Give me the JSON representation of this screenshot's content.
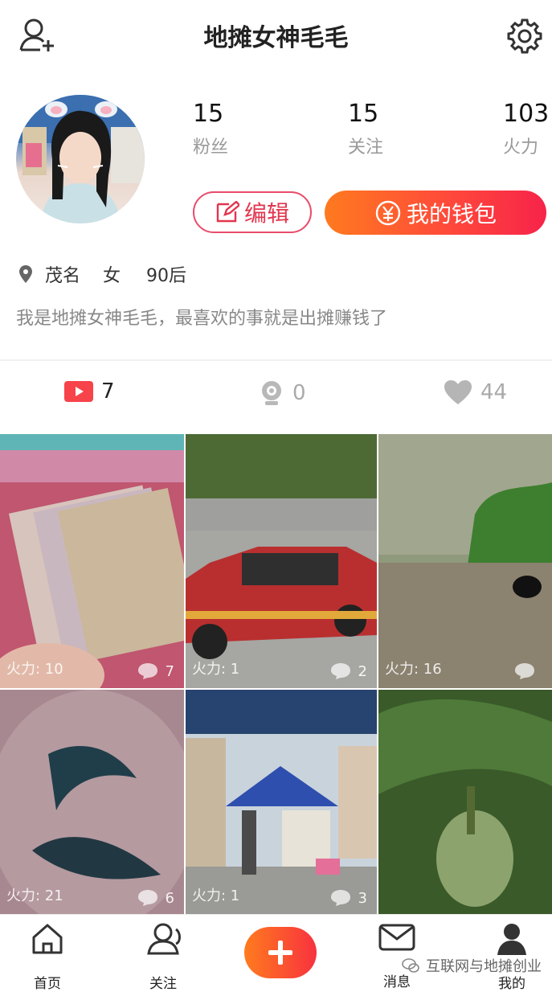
{
  "header": {
    "title": "地摊女神毛毛"
  },
  "profile": {
    "stats": [
      {
        "value": "15",
        "label": "粉丝"
      },
      {
        "value": "15",
        "label": "关注"
      },
      {
        "value": "103",
        "label": "火力"
      }
    ],
    "edit_label": "编辑",
    "wallet_label": "我的钱包",
    "location": "茂名",
    "gender": "女",
    "age": "90后",
    "bio": "我是地摊女神毛毛，最喜欢的事就是出摊赚钱了"
  },
  "tabs": [
    {
      "icon": "video-icon",
      "count": "7"
    },
    {
      "icon": "camera-icon",
      "count": "0"
    },
    {
      "icon": "heart-icon",
      "count": "44"
    }
  ],
  "grid": [
    {
      "fire": "火力: 10",
      "comments": "7"
    },
    {
      "fire": "火力: 1",
      "comments": "2"
    },
    {
      "fire": "火力: 16",
      "comments": ""
    },
    {
      "fire": "火力: 21",
      "comments": "6"
    },
    {
      "fire": "火力: 1",
      "comments": "3"
    },
    {
      "fire": "",
      "comments": ""
    }
  ],
  "nav": [
    {
      "label": "首页"
    },
    {
      "label": "关注"
    },
    {
      "label": "消息"
    },
    {
      "label": "我的"
    }
  ],
  "watermark": "互联网与地摊创业",
  "colors": {
    "accent": "#f7234a",
    "orange": "#ff7a1f"
  }
}
